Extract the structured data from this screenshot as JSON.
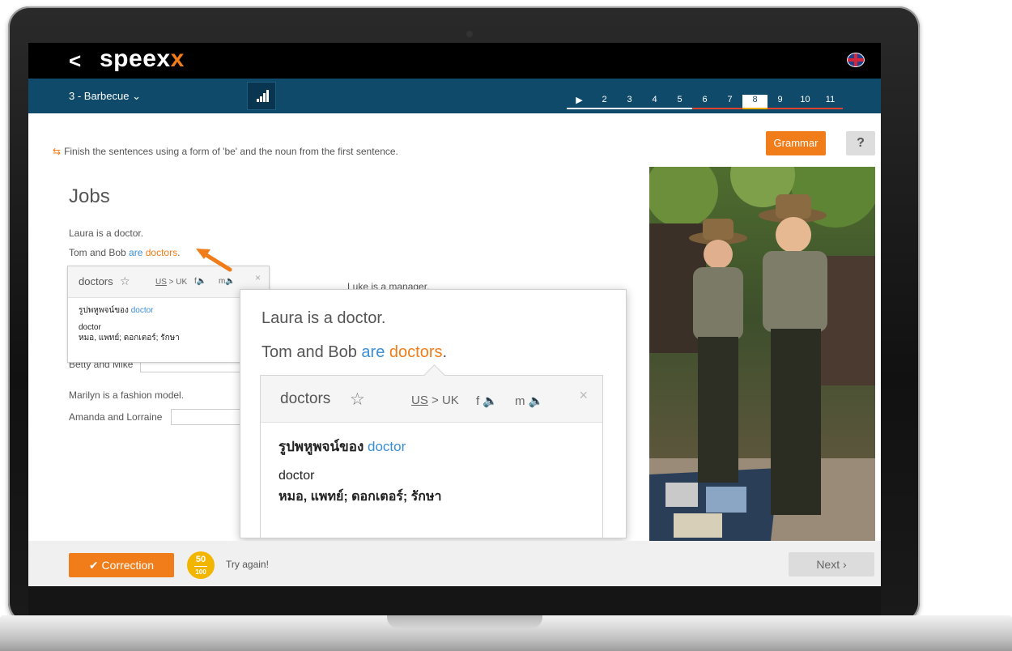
{
  "app": {
    "logo_main": "speex",
    "logo_accent": "x",
    "back_symbol": "<"
  },
  "nav": {
    "lesson": "3 - Barbecue",
    "steps": [
      {
        "label": "▶",
        "state": "play"
      },
      {
        "label": "2",
        "state": "done"
      },
      {
        "label": "3",
        "state": "done"
      },
      {
        "label": "4",
        "state": "done"
      },
      {
        "label": "5",
        "state": "done"
      },
      {
        "label": "6",
        "state": "todo"
      },
      {
        "label": "7",
        "state": "todo"
      },
      {
        "label": "8",
        "state": "active"
      },
      {
        "label": "9",
        "state": "todo"
      },
      {
        "label": "10",
        "state": "todo"
      },
      {
        "label": "11",
        "state": "todo"
      }
    ]
  },
  "content": {
    "grammar_label": "Grammar",
    "help_label": "?",
    "instruction": "Finish the sentences using a form of 'be' and the noun from the first sentence.",
    "title": "Jobs",
    "s1": "Laura is a doctor.",
    "s2_prefix": "Tom and Bob ",
    "s2_verb": "are",
    "s2_noun": "doctors",
    "s2_end": ".",
    "s3": "Luke is a manager.",
    "s4_prefix": "Betty and Mike",
    "s5": "Marilyn is a fashion model.",
    "s6_prefix": "Amanda and Lorraine"
  },
  "popup": {
    "word": "doctors",
    "lang_us": "US",
    "lang_rest": " > UK",
    "snd_f": "f",
    "snd_m": "m",
    "close": "×",
    "thai_label": "รูปพหูพจน์ของ ",
    "thai_link": "doctor",
    "root": "doctor",
    "translation": "หมอ, แพทย์; ดอกเตอร์; รักษา"
  },
  "footer": {
    "correction_label": "Correction",
    "score_top": "50",
    "score_bottom": "100",
    "try_again": "Try again!",
    "next_label": "Next"
  },
  "colors": {
    "accent": "#f07d1a",
    "nav_bg": "#0f4a6b",
    "link": "#3a8ed8"
  }
}
